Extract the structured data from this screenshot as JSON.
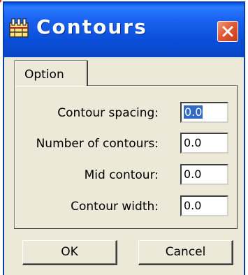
{
  "window": {
    "title": "Contours",
    "titlebar_color": "#0a52e6",
    "close_color": "#e25a36"
  },
  "tabs": [
    {
      "label": "Option",
      "selected": true
    }
  ],
  "fields": [
    {
      "label": "Contour spacing:",
      "value": "0.0",
      "selected": true
    },
    {
      "label": "Number of contours:",
      "value": "0.0",
      "selected": false
    },
    {
      "label": "Mid contour:",
      "value": "0.0",
      "selected": false
    },
    {
      "label": "Contour width:",
      "value": "0.0",
      "selected": false
    }
  ],
  "buttons": {
    "ok": "OK",
    "cancel": "Cancel"
  },
  "icons": {
    "app": "contours-app-icon",
    "close": "close-icon"
  }
}
